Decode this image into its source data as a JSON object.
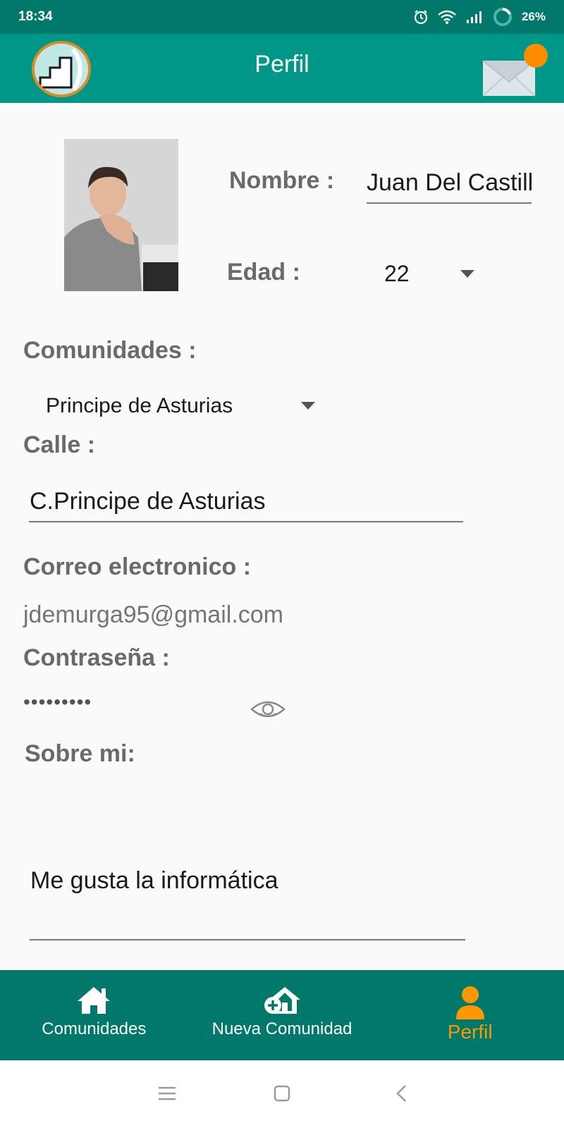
{
  "status_bar": {
    "time": "18:34",
    "battery": "26%",
    "icons": [
      "alarm-icon",
      "wifi-icon",
      "signal-icon",
      "battery-icon"
    ]
  },
  "app_bar": {
    "title": "Perfil",
    "logo_icon": "stairs-logo-icon",
    "mail_icon": "mail-icon",
    "notification_color": "#ff8c00"
  },
  "profile": {
    "name_label": "Nombre :",
    "name_value": "Juan Del Castillo",
    "age_label": "Edad :",
    "age_value": "22",
    "communities_label": "Comunidades :",
    "community_value": "Principe de Asturias",
    "street_label": "Calle :",
    "street_value": "C.Principe de Asturias",
    "email_label": "Correo electronico :",
    "email_value": "jdemurga95@gmail.com",
    "password_label": "Contraseña :",
    "password_value": "•••••••••",
    "about_label": "Sobre mi:",
    "about_value": "Me gusta la informática"
  },
  "bottom_nav": {
    "items": [
      {
        "label": "Comunidades",
        "icon": "home-icon",
        "active": false
      },
      {
        "label": "Nueva Comunidad",
        "icon": "add-home-icon",
        "active": false
      },
      {
        "label": "Perfil",
        "icon": "person-icon",
        "active": true
      }
    ],
    "active_color": "#ff9800",
    "bg_color": "#00796b"
  },
  "system_nav": {
    "icons": [
      "menu-icon",
      "home-square-icon",
      "back-icon"
    ]
  }
}
